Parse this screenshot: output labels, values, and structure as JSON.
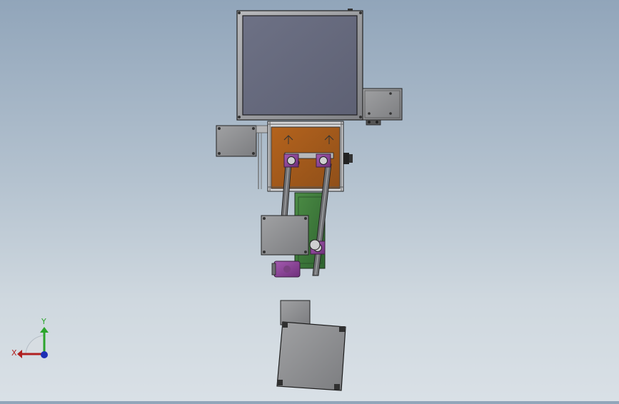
{
  "scene": {
    "view_type": "cad-top-view",
    "background_top": "#91a5ba",
    "background_bottom": "#d9e0e6"
  },
  "axes": {
    "x_label": "X",
    "y_label": "Y",
    "x_color": "#b02020",
    "y_color": "#2ca52c",
    "z_color": "#1d2fb5"
  },
  "parts": {
    "large_frame_color": "#8e8f93",
    "dark_panel_color": "#676a79",
    "orange_plate_color": "#a05a1d",
    "green_plate_color": "#3f7a3b",
    "purple_part_color": "#8b3d97",
    "gray_block_color": "#8d8e90"
  }
}
